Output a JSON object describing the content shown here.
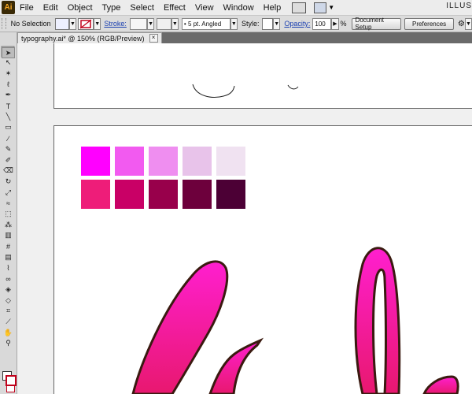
{
  "menubar": {
    "logo": "Ai",
    "items": [
      "File",
      "Edit",
      "Object",
      "Type",
      "Select",
      "Effect",
      "View",
      "Window",
      "Help"
    ],
    "workspace_label": "ILLUS"
  },
  "control_bar": {
    "selection": "No Selection",
    "stroke_label": "Stroke:",
    "brush_value": "5 pt. Angled",
    "style_label": "Style:",
    "opacity_label": "Opacity:",
    "opacity_value": "100",
    "opacity_unit": "%",
    "document_setup": "Document Setup",
    "preferences": "Preferences"
  },
  "document": {
    "tab_title": "typography.ai* @ 150% (RGB/Preview)",
    "close_glyph": "×"
  },
  "tools": [
    "selection-icon",
    "direct-selection-icon",
    "magic-wand-icon",
    "lasso-icon",
    "pen-icon",
    "type-icon",
    "line-icon",
    "rectangle-icon",
    "paintbrush-icon",
    "pencil-icon",
    "blob-brush-icon",
    "eraser-icon",
    "rotate-icon",
    "scale-icon",
    "warp-icon",
    "free-transform-icon",
    "symbol-sprayer-icon",
    "column-graph-icon",
    "mesh-icon",
    "gradient-icon",
    "eyedropper-icon",
    "blend-icon",
    "live-paint-icon",
    "live-paint-selection-icon",
    "crop-icon",
    "slice-icon",
    "hand-icon",
    "zoom-icon"
  ],
  "swatch_colors": {
    "row1": [
      "#ff00ff",
      "#f25af0",
      "#ef8ef0",
      "#e8c3ea",
      "#f0e2f1"
    ],
    "row2": [
      "#ee1d79",
      "#c90066",
      "#98004b",
      "#6d003c",
      "#4c0035"
    ]
  },
  "colors": {
    "letter_fill_top": "#ff1fcf",
    "letter_fill_bottom": "#e8186f",
    "letter_stroke": "#3a1a10"
  }
}
